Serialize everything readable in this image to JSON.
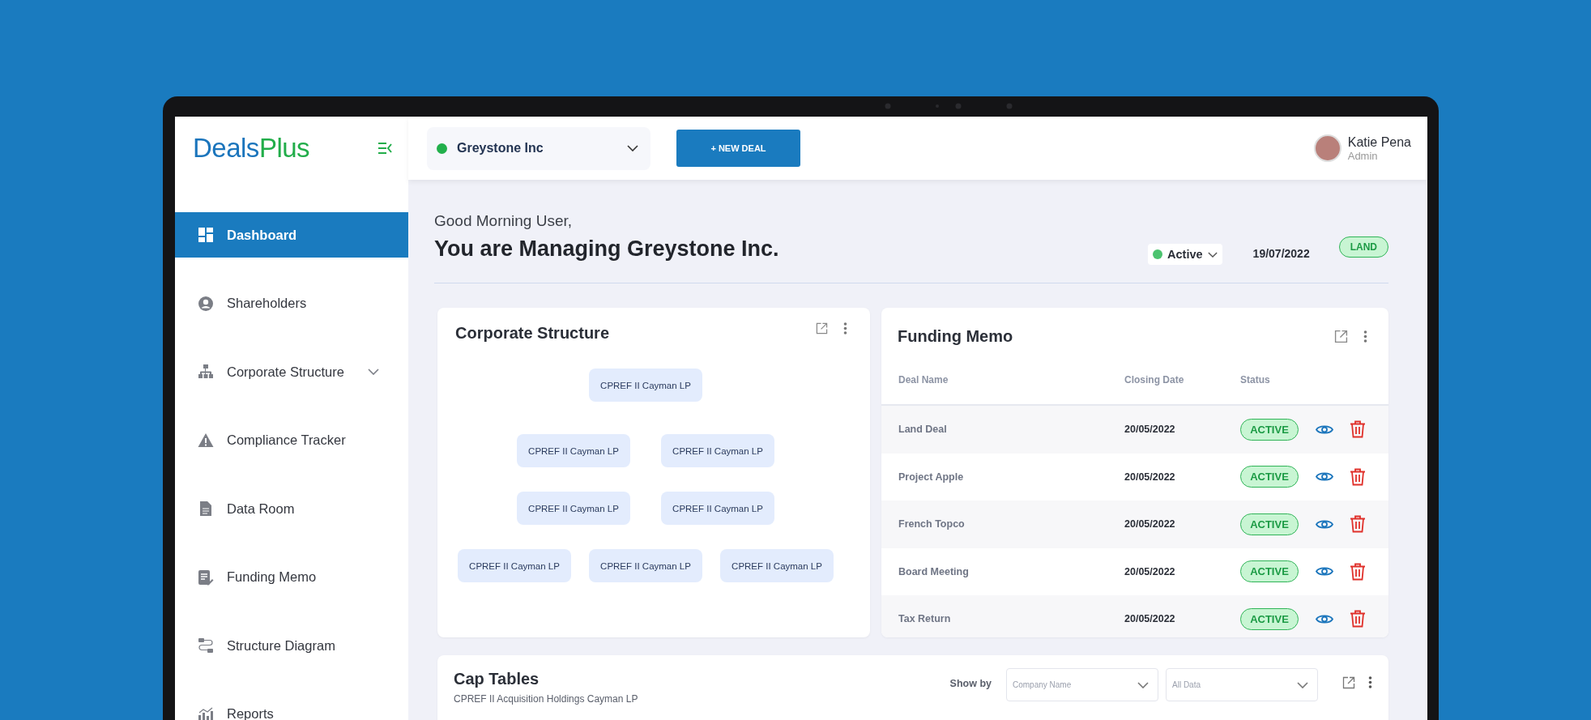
{
  "logo": [
    {
      "text": "Deals",
      "color": "#1b75bc"
    },
    {
      "text": "Plus",
      "color": "#22ad4a"
    }
  ],
  "company_selector": {
    "value": "Greystone Inc"
  },
  "new_deal_button": "+ NEW DEAL",
  "user": {
    "name": "Katie Pena",
    "role": "Admin"
  },
  "sidebar": {
    "items": [
      {
        "label": "Dashboard",
        "selected": true,
        "expandable": false
      },
      {
        "label": "Shareholders",
        "selected": false,
        "expandable": false
      },
      {
        "label": "Corporate Structure",
        "selected": false,
        "expandable": true
      },
      {
        "label": "Compliance Tracker",
        "selected": false,
        "expandable": false
      },
      {
        "label": "Data Room",
        "selected": false,
        "expandable": false
      },
      {
        "label": "Funding Memo",
        "selected": false,
        "expandable": false
      },
      {
        "label": "Structure Diagram",
        "selected": false,
        "expandable": false
      },
      {
        "label": "Reports",
        "selected": false,
        "expandable": false
      }
    ]
  },
  "greeting": "Good Morning User,",
  "heading": "You are Managing Greystone Inc.",
  "status_dropdown": {
    "value": "Active"
  },
  "date": "19/07/2022",
  "tag": "LAND",
  "corporate_structure": {
    "title": "Corporate Structure",
    "rows": [
      [
        "CPREF II Cayman LP"
      ],
      [
        "CPREF II Cayman LP",
        "CPREF II Cayman LP"
      ],
      [
        "CPREF II Cayman LP",
        "CPREF II Cayman LP"
      ],
      [
        "CPREF II Cayman LP",
        "CPREF II Cayman LP",
        "CPREF II Cayman LP"
      ]
    ]
  },
  "funding_memo": {
    "title": "Funding Memo",
    "columns": [
      "Deal Name",
      "Closing Date",
      "Status"
    ],
    "rows": [
      {
        "deal_name": "Land Deal",
        "closing_date": "20/05/2022",
        "status": "ACTIVE"
      },
      {
        "deal_name": "Project Apple",
        "closing_date": "20/05/2022",
        "status": "ACTIVE"
      },
      {
        "deal_name": "French Topco",
        "closing_date": "20/05/2022",
        "status": "ACTIVE"
      },
      {
        "deal_name": "Board Meeting",
        "closing_date": "20/05/2022",
        "status": "ACTIVE"
      },
      {
        "deal_name": "Tax Return",
        "closing_date": "20/05/2022",
        "status": "ACTIVE"
      }
    ]
  },
  "cap_tables": {
    "title": "Cap Tables",
    "subtitle": "CPREF II Acquisition Holdings Cayman LP",
    "show_by_label": "Show by",
    "filters": [
      {
        "placeholder": "Company Name"
      },
      {
        "placeholder": "All Data"
      }
    ]
  }
}
